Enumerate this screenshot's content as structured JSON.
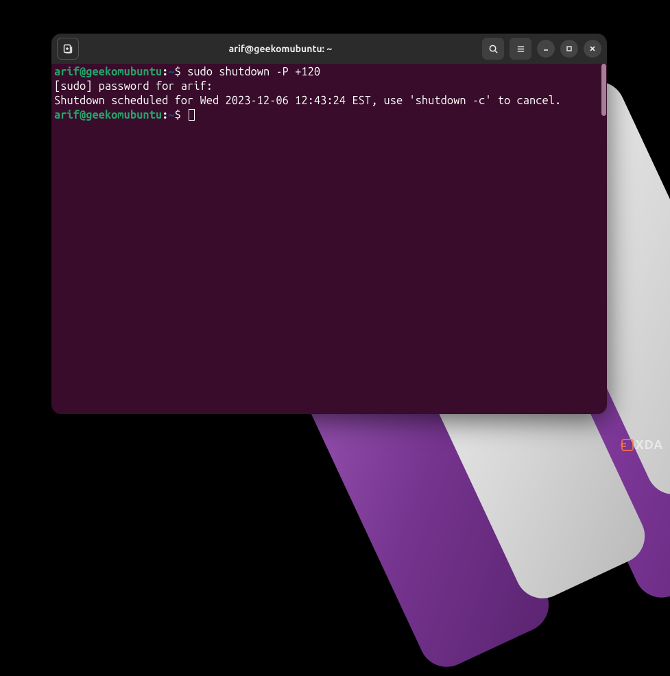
{
  "window": {
    "title": "arif@geekomubuntu: ~"
  },
  "terminal": {
    "lines": [
      {
        "prompt": {
          "user_host": "arif@geekomubuntu",
          "path": "~"
        },
        "command": "sudo shutdown -P +120"
      },
      {
        "output": "[sudo] password for arif:"
      },
      {
        "output": "Shutdown scheduled for Wed 2023-12-06 12:43:24 EST, use 'shutdown -c' to cancel."
      },
      {
        "prompt": {
          "user_host": "arif@geekomubuntu",
          "path": "~"
        },
        "cursor": true
      }
    ]
  },
  "watermark": {
    "text": "XDA"
  }
}
